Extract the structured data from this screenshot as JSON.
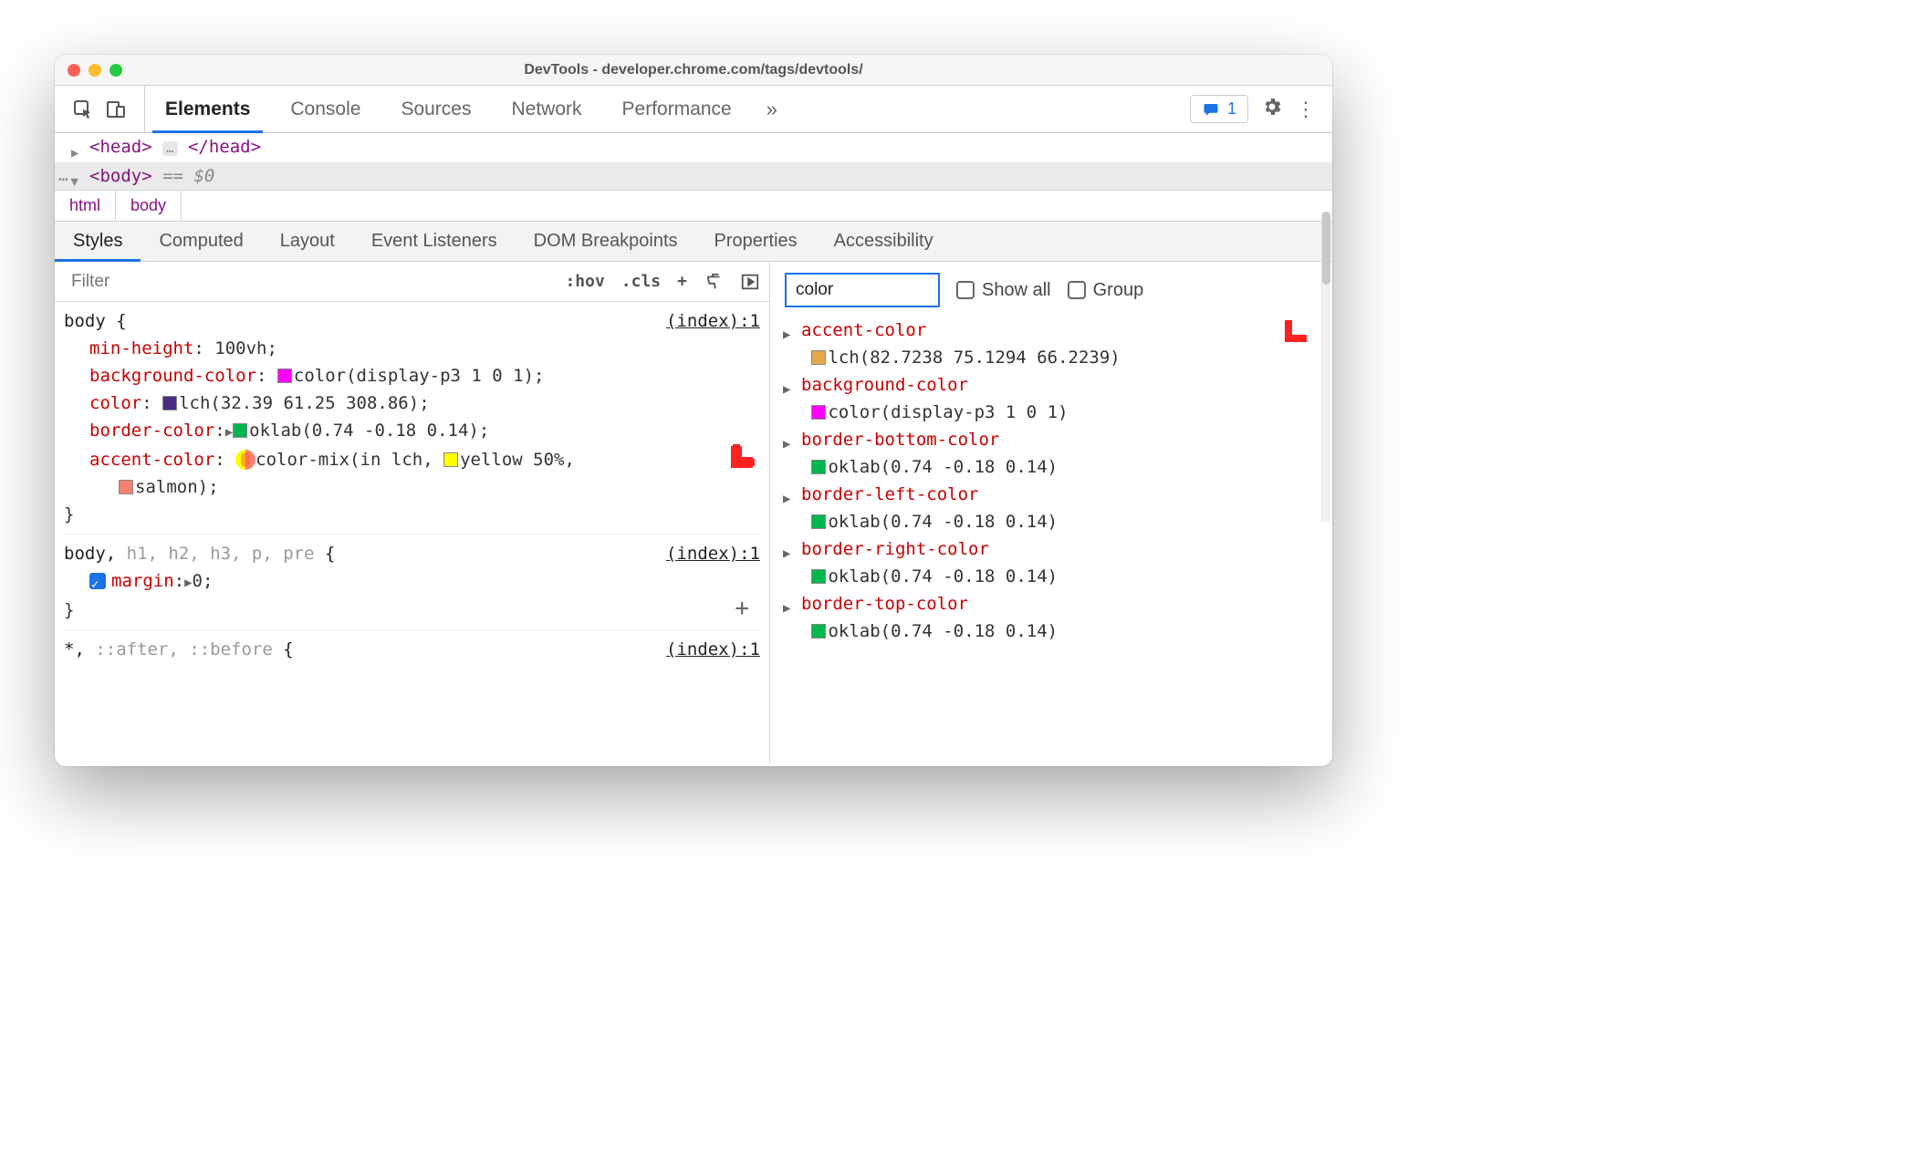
{
  "window": {
    "title": "DevTools - developer.chrome.com/tags/devtools/"
  },
  "tabs": {
    "main": [
      "Elements",
      "Console",
      "Sources",
      "Network",
      "Performance"
    ],
    "active": "Elements",
    "overflow": "»"
  },
  "toolbar": {
    "issues_count": "1",
    "gear": "⚙",
    "kebab": "⋮"
  },
  "dom": {
    "head": {
      "open": "<head>",
      "ellipsis": "…",
      "close": "</head>"
    },
    "body": {
      "open": "<body>",
      "eq": "==",
      "dollar": "$0"
    }
  },
  "crumbs": [
    "html",
    "body"
  ],
  "subtabs": {
    "items": [
      "Styles",
      "Computed",
      "Layout",
      "Event Listeners",
      "DOM Breakpoints",
      "Properties",
      "Accessibility"
    ],
    "active": "Styles"
  },
  "styles": {
    "filter_placeholder": "Filter",
    "hov": ":hov",
    "cls": ".cls",
    "plus": "+",
    "rules": [
      {
        "selector_html": "body {",
        "source": "(index):1",
        "decls": [
          {
            "prop": "min-height",
            "val": "100vh;"
          },
          {
            "prop": "background-color",
            "swatch": "sw-magenta",
            "val": "color(display-p3 1 0 1);"
          },
          {
            "prop": "color",
            "swatch": "sw-purple",
            "val": "lch(32.39 61.25 308.86);"
          },
          {
            "prop": "border-color",
            "tri": true,
            "swatch": "sw-green",
            "val": "oklab(0.74 -0.18 0.14);"
          },
          {
            "prop": "accent-color",
            "mix": true,
            "val_prefix": "color-mix(in lch, ",
            "swatch2": "sw-yellow",
            "val_mid": "yellow 50%,",
            "swatch3": "sw-salmon",
            "val_end": "salmon);"
          }
        ],
        "close": "}"
      },
      {
        "selector_main": "body,",
        "selector_dim": " h1, h2, h3, p, pre",
        "brace": " {",
        "source": "(index):1",
        "decls": [
          {
            "checked": true,
            "prop": "margin",
            "tri": true,
            "val": "0;"
          }
        ],
        "close": "}"
      },
      {
        "selector_main": "*,",
        "selector_dim": " ::after, ::before",
        "brace": " {",
        "source": "(index):1",
        "decls": []
      }
    ]
  },
  "computed": {
    "filter_value": "color",
    "show_all": "Show all",
    "group": "Group",
    "rows": [
      {
        "prop": "accent-color",
        "swatch": "sw-orange",
        "val": "lch(82.7238 75.1294 66.2239)"
      },
      {
        "prop": "background-color",
        "swatch": "sw-magenta",
        "val": "color(display-p3 1 0 1)"
      },
      {
        "prop": "border-bottom-color",
        "swatch": "sw-green",
        "val": "oklab(0.74 -0.18 0.14)"
      },
      {
        "prop": "border-left-color",
        "swatch": "sw-green",
        "val": "oklab(0.74 -0.18 0.14)"
      },
      {
        "prop": "border-right-color",
        "swatch": "sw-green",
        "val": "oklab(0.74 -0.18 0.14)"
      },
      {
        "prop": "border-top-color",
        "swatch": "sw-green",
        "val": "oklab(0.74 -0.18 0.14)"
      }
    ]
  }
}
